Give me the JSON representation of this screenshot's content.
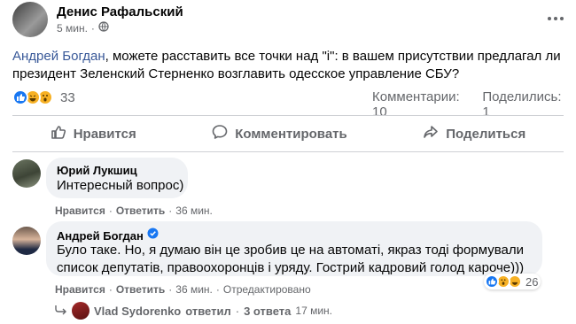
{
  "post": {
    "author": "Денис Рафальский",
    "time": "5 мин.",
    "text_mention": "Андрей Богдан",
    "text_rest_line1": ", можете расставить все точки над \"і\": в вашем присутствии предлагал ли",
    "text_line2": "президент Зеленский Стерненко возглавить одесское управление СБУ?",
    "reactions_count": "33",
    "comments_count": "Комментарии: 10",
    "shares_count": "Поделились: 1"
  },
  "actions": {
    "like": "Нравится",
    "comment": "Комментировать",
    "share": "Поделиться"
  },
  "comments": [
    {
      "author": "Юрий Лукшиц",
      "text": "Интересный вопрос)",
      "like": "Нравится",
      "reply": "Ответить",
      "time": "36 мин."
    },
    {
      "author": "Андрей Богдан",
      "text_line1": "Було таке. Но, я думаю він це зробив це на автоматі, якраз тоді формували",
      "text_line2": "список депутатів, правоохоронців і уряду. Гострий кадровий голод кароче)))",
      "like": "Нравится",
      "reply": "Ответить",
      "time": "36 мин.",
      "edited": "Отредактировано",
      "reactions_count": "26"
    }
  ],
  "replies": {
    "author": "Vlad Sydorenko",
    "verb": "ответил",
    "count": "3 ответа",
    "time": "17 мин."
  },
  "colors": {
    "link": "#385898",
    "like_blue": "#1877f2",
    "emoji_yellow": "#f7b125",
    "secondary_text": "#65676b"
  }
}
